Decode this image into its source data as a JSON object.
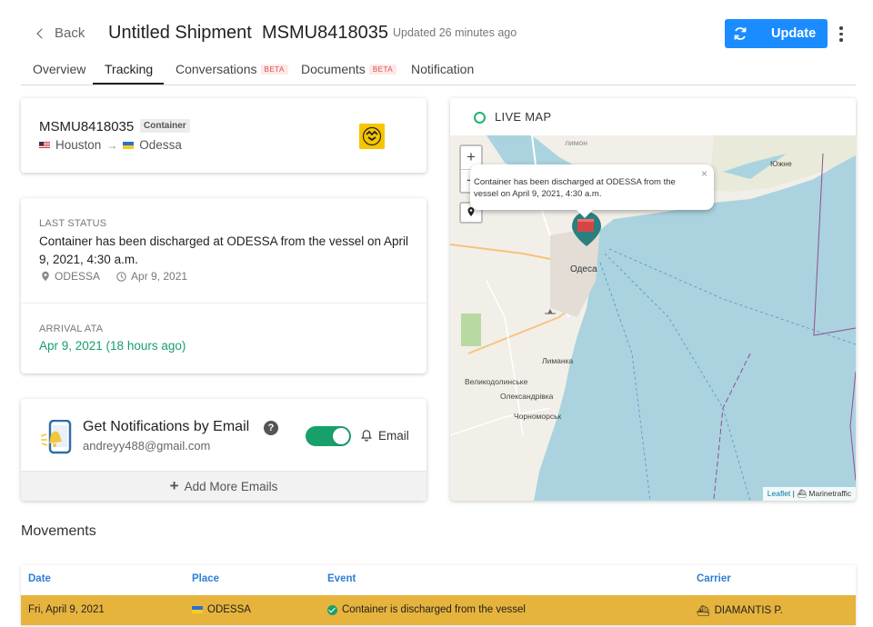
{
  "header": {
    "back_label": "Back",
    "title": "Untitled Shipment",
    "shipment_number": "MSMU8418035",
    "updated": "Updated 26 minutes ago",
    "update_button": "Update",
    "accent_color": "#1a8cff"
  },
  "tabs": [
    {
      "label": "Overview",
      "active": false
    },
    {
      "label": "Tracking",
      "active": true
    },
    {
      "label": "Conversations",
      "badge": "BETA",
      "active": false
    },
    {
      "label": "Documents",
      "badge": "BETA",
      "active": false
    },
    {
      "label": "Notification",
      "active": false
    }
  ],
  "container": {
    "number": "MSMU8418035",
    "type_badge": "Container",
    "origin": "Houston",
    "destination": "Odessa",
    "carrier_logo": "msc-logo"
  },
  "last_status": {
    "label": "LAST STATUS",
    "text": "Container has been discharged at ODESSA from the vessel on April 9, 2021, 4:30 a.m.",
    "location": "ODESSA",
    "date": "Apr 9, 2021"
  },
  "arrival": {
    "label": "ARRIVAL ATA",
    "value": "Apr 9, 2021  (18 hours ago)",
    "color": "#17a06a"
  },
  "notifications": {
    "title": "Get Notifications by Email",
    "email": "andreyy488@gmail.com",
    "toggle_on": true,
    "channel_label": "Email",
    "add_more": "Add More Emails"
  },
  "map": {
    "title": "LIVE MAP",
    "zoom_in": "+",
    "zoom_out": "−",
    "popup": "Container has been discharged at ODESSA from the vessel on April 9, 2021, 4:30 a.m.",
    "popup_close": "×",
    "attribution_leaflet": "Leaflet",
    "attribution_sep": " | ",
    "attribution_source": "Marinetraffic",
    "labels": {
      "odesa": "Одеса",
      "yuzhne": "Южне",
      "lymanka": "Лиманка",
      "velykodolynske": "Великодолинське",
      "oleksandrivka": "Олександрівка",
      "chornomorsk": "Чорноморськ",
      "lymon": "лимон"
    }
  },
  "movements": {
    "title": "Movements",
    "columns": [
      "Date",
      "Place",
      "Event",
      "Carrier"
    ],
    "rows": [
      {
        "date": "Fri, April 9, 2021",
        "place": "ODESSA",
        "event": "Container is discharged from the vessel",
        "carrier": "DIAMANTIS P."
      }
    ]
  }
}
